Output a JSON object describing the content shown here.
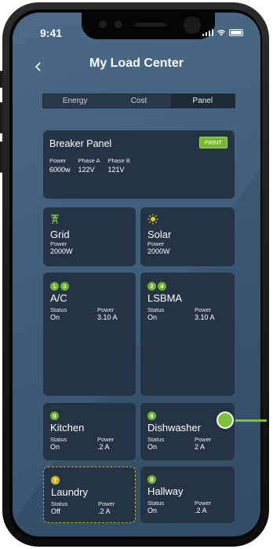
{
  "status_bar": {
    "time": "9:41"
  },
  "header": {
    "title": "My Load Center"
  },
  "tabs": [
    {
      "label": "Energy",
      "active": false
    },
    {
      "label": "Cost",
      "active": false
    },
    {
      "label": "Panel",
      "active": true
    }
  ],
  "breaker_panel": {
    "title": "Breaker Panel",
    "print_label": "PRINT",
    "cols": [
      {
        "label": "Power",
        "value": "6000w"
      },
      {
        "label": "Phase A",
        "value": "122V"
      },
      {
        "label": "Phase B",
        "value": "121V"
      }
    ]
  },
  "grid": {
    "icon": "transmission-tower-icon",
    "name": "Grid",
    "label": "Power",
    "value": "2000W"
  },
  "solar": {
    "icon": "sun-icon",
    "name": "Solar",
    "label": "Power",
    "value": "2000W"
  },
  "loads": [
    {
      "badges": [
        "1",
        "3"
      ],
      "badge_color": "green",
      "name": "A/C",
      "status_label": "Status",
      "status": "On",
      "power_label": "Power",
      "power": "3.10 A"
    },
    {
      "badges": [
        "2",
        "4"
      ],
      "badge_color": "green",
      "name": "LSBMA",
      "status_label": "Status",
      "status": "On",
      "power_label": "Power",
      "power": "3.10 A"
    },
    {
      "badges": [
        "5"
      ],
      "badge_color": "green",
      "name": "Kitchen",
      "status_label": "Status",
      "status": "On",
      "power_label": "Power",
      "power": ".2 A"
    },
    {
      "badges": [
        "6"
      ],
      "badge_color": "green",
      "name": "Dishwasher",
      "status_label": "Status",
      "status": "On",
      "power_label": "Power",
      "power": "2 A"
    },
    {
      "badges": [
        "7"
      ],
      "badge_color": "yellow",
      "name": "Laundry",
      "status_label": "Status",
      "status": "Off",
      "power_label": "Power",
      "power": ".2 A"
    },
    {
      "badges": [
        "8"
      ],
      "badge_color": "green",
      "name": "Hallway",
      "status_label": "Status",
      "status": "On",
      "power_label": "Power",
      "power": ".2 A"
    }
  ],
  "colors": {
    "accent_green": "#77b82a",
    "accent_yellow": "#d8b41c",
    "card_bg": "#243445"
  }
}
